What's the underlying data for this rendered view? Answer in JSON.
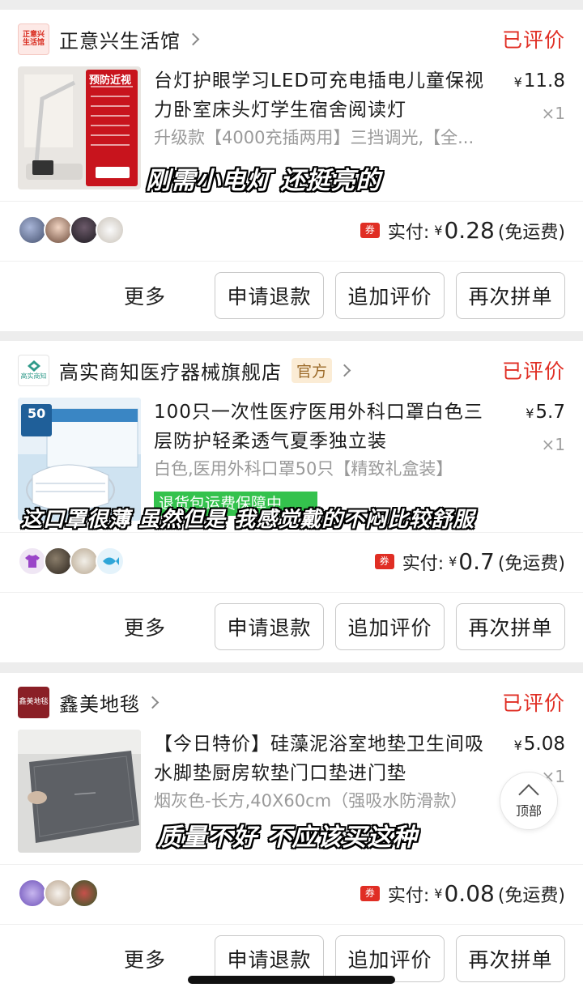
{
  "orders": [
    {
      "shop_logo_text": [
        "正意兴",
        "生活馆"
      ],
      "shop_name": "正意兴生活馆",
      "official_badge": "",
      "status": "已评价",
      "title": "台灯护眼学习LED可充电插电儿童保视力卧室床头灯学生宿舍阅读灯",
      "spec": "升级款【4000充插两用】三挡调光,【全...",
      "price_symbol": "¥",
      "price": "11.8",
      "qty": "×1",
      "thumb_badge": "预防近视",
      "caption": "刚需小电灯 还挺亮的",
      "promo": "",
      "pay_label": "实付:",
      "pay_amount": "0.28",
      "pay_note": "(免运费)",
      "coupon": "券"
    },
    {
      "shop_logo_text": [
        "高实商知"
      ],
      "shop_name": "高实商知医疗器械旗舰店",
      "official_badge": "官方",
      "status": "已评价",
      "title": "100只一次性医疗医用外科口罩白色三层防护轻柔透气夏季独立装",
      "spec": "白色,医用外科口罩50只【精致礼盒装】",
      "price_symbol": "¥",
      "price": "5.7",
      "qty": "×1",
      "thumb_badge": "50",
      "caption": "这口罩很薄 虽然但是 我感觉戴的不闷比较舒服",
      "promo": "退货包运费保障中",
      "pay_label": "实付:",
      "pay_amount": "0.7",
      "pay_note": "(免运费)",
      "coupon": "券"
    },
    {
      "shop_logo_text": [
        "鑫美地毯"
      ],
      "shop_name": "鑫美地毯",
      "official_badge": "",
      "status": "已评价",
      "title": "【今日特价】硅藻泥浴室地垫卫生间吸水脚垫厨房软垫门口垫进门垫",
      "spec": "烟灰色-长方,40X60cm（强吸水防滑款）",
      "price_symbol": "¥",
      "price": "5.08",
      "qty": "×1",
      "thumb_badge": "",
      "caption": "质量不好 不应该买这种",
      "promo": "",
      "pay_label": "实付:",
      "pay_amount": "0.08",
      "pay_note": "(免运费)",
      "coupon": "券"
    }
  ],
  "actions": {
    "more": "更多",
    "refund": "申请退款",
    "add_review": "追加评价",
    "reorder": "再次拼单"
  },
  "back_to_top": "顶部",
  "colors": {
    "accent_red": "#e02e24",
    "promo_green": "#34c24d",
    "official_bg": "#fbecd5"
  }
}
